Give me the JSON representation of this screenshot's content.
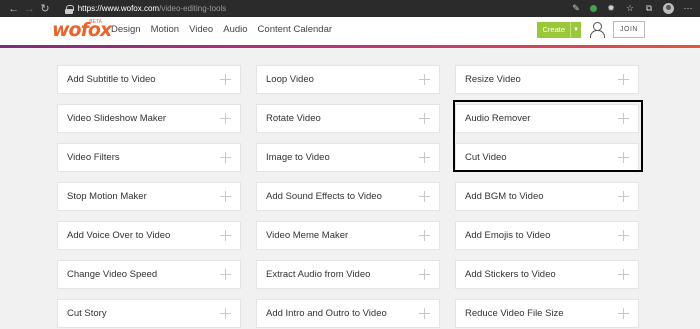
{
  "browser": {
    "url_domain": "https://www.wofox.com",
    "url_path": "/video-editing-tools",
    "back_icon": "back-arrow",
    "forward_icon": "forward-arrow",
    "reload_icon": "reload"
  },
  "header": {
    "logo": "wofox",
    "logo_sup": "BETA",
    "nav": [
      "Design",
      "Motion",
      "Video",
      "Audio",
      "Content Calendar"
    ],
    "create_label": "Create",
    "join_label": "JOIN",
    "accent": "#9bc83a",
    "brand_color": "#e9632a"
  },
  "tools": [
    [
      "Add Subtitle to Video",
      "Loop Video",
      "Resize Video"
    ],
    [
      "Video Slideshow Maker",
      "Rotate Video",
      "Audio Remover"
    ],
    [
      "Video Filters",
      "Image to Video",
      "Cut Video"
    ],
    [
      "Stop Motion Maker",
      "Add Sound Effects to Video",
      "Add BGM to Video"
    ],
    [
      "Add Voice Over to Video",
      "Video Meme Maker",
      "Add Emojis to Video"
    ],
    [
      "Change Video Speed",
      "Extract Audio from Video",
      "Add Stickers to Video"
    ],
    [
      "Cut Story",
      "Add Intro and Outro to Video",
      "Reduce Video File Size"
    ]
  ]
}
